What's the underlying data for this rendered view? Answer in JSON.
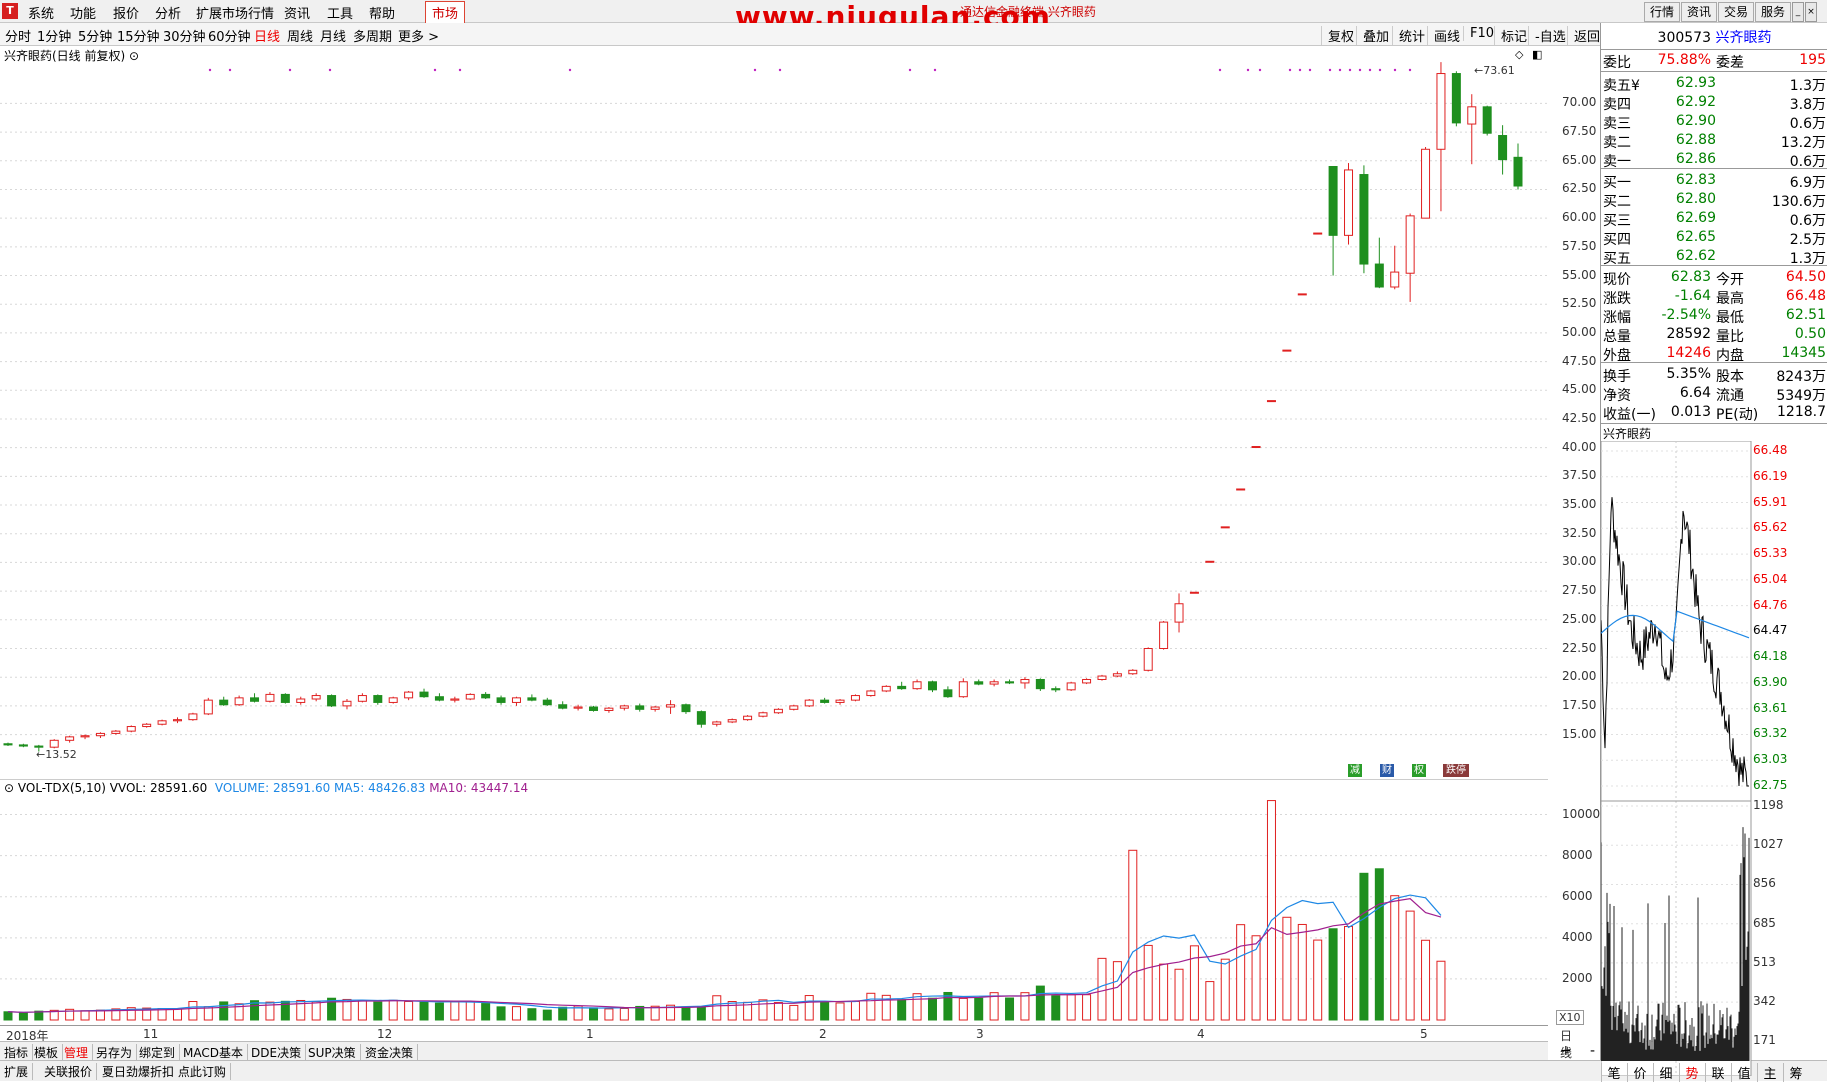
{
  "menu": {
    "items": [
      "系统",
      "功能",
      "报价",
      "分析",
      "扩展市场行情",
      "资讯",
      "工具",
      "帮助"
    ],
    "market_label": "市场",
    "watermark": "www.niugulan.com",
    "title": "通达信金融终端 兴齐眼药",
    "right_buttons": [
      "行情",
      "资讯",
      "交易",
      "服务"
    ]
  },
  "periods": {
    "items": [
      "分时",
      "1分钟",
      "5分钟",
      "15分钟",
      "30分钟",
      "60分钟",
      "日线",
      "周线",
      "月线",
      "多周期",
      "更多 >"
    ],
    "active": "日线",
    "tools": [
      "复权",
      "叠加",
      "统计",
      "画线",
      "F10",
      "标记",
      "-自选",
      "返回"
    ]
  },
  "chart": {
    "title": "兴齐眼药(日线 前复权)",
    "y_labels": [
      "70.00",
      "67.50",
      "65.00",
      "62.50",
      "60.00",
      "57.50",
      "55.00",
      "52.50",
      "50.00",
      "47.50",
      "45.00",
      "42.50",
      "40.00",
      "37.50",
      "35.00",
      "32.50",
      "30.00",
      "27.50",
      "25.00",
      "22.50",
      "20.00",
      "17.50",
      "15.00"
    ],
    "high_marker": "73.61",
    "low_marker": "13.52",
    "indicator_buttons": [
      "减",
      "财",
      "权",
      "跌停"
    ]
  },
  "volume": {
    "legend_name": "VOL-TDX(5,10)",
    "vvol": "VVOL: 28591.60",
    "volume": "VOLUME: 28591.60",
    "ma5": "MA5: 48426.83",
    "ma10": "MA10: 43447.14",
    "y_labels": [
      "10000",
      "8000",
      "6000",
      "4000",
      "2000"
    ],
    "unit": "X10"
  },
  "dates": {
    "labels": [
      "2018年",
      "11",
      "12",
      "1",
      "2",
      "3",
      "4",
      "5"
    ],
    "period_label": "日线"
  },
  "bottom": {
    "row1": [
      "指标",
      "模板",
      "管理",
      "另存为",
      "绑定到",
      "MACD基本",
      "DDE决策",
      "SUP决策",
      "资金决策"
    ],
    "row1_active": "管理",
    "row2": [
      "扩展",
      "关联报价",
      "夏日劲爆折扣 点此订购"
    ]
  },
  "quote": {
    "code": "300573",
    "name": "兴齐眼药",
    "weibi_label": "委比",
    "weibi": "75.88%",
    "weicha_label": "委差",
    "weicha": "195",
    "sells": [
      {
        "label": "卖五",
        "mark": "¥",
        "price": "62.93",
        "vol": "1.3万"
      },
      {
        "label": "卖四",
        "mark": "",
        "price": "62.92",
        "vol": "3.8万"
      },
      {
        "label": "卖三",
        "mark": "",
        "price": "62.90",
        "vol": "0.6万"
      },
      {
        "label": "卖二",
        "mark": "",
        "price": "62.88",
        "vol": "13.2万"
      },
      {
        "label": "卖一",
        "mark": "",
        "price": "62.86",
        "vol": "0.6万"
      }
    ],
    "buys": [
      {
        "label": "买一",
        "price": "62.83",
        "vol": "6.9万"
      },
      {
        "label": "买二",
        "price": "62.80",
        "vol": "130.6万"
      },
      {
        "label": "买三",
        "price": "62.69",
        "vol": "0.6万"
      },
      {
        "label": "买四",
        "price": "62.65",
        "vol": "2.5万"
      },
      {
        "label": "买五",
        "price": "62.62",
        "vol": "1.3万"
      }
    ],
    "stats": [
      {
        "l1": "现价",
        "v1": "62.83",
        "c1": "green",
        "l2": "今开",
        "v2": "64.50",
        "c2": "red"
      },
      {
        "l1": "涨跌",
        "v1": "-1.64",
        "c1": "green",
        "l2": "最高",
        "v2": "66.48",
        "c2": "red"
      },
      {
        "l1": "涨幅",
        "v1": "-2.54%",
        "c1": "green",
        "l2": "最低",
        "v2": "62.51",
        "c2": "green"
      },
      {
        "l1": "总量",
        "v1": "28592",
        "c1": "black",
        "l2": "量比",
        "v2": "0.50",
        "c2": "green"
      },
      {
        "l1": "外盘",
        "v1": "14246",
        "c1": "red",
        "l2": "内盘",
        "v2": "14345",
        "c2": "green"
      }
    ],
    "stats2": [
      {
        "l1": "换手",
        "v1": "5.35%",
        "l2": "股本",
        "v2": "8243万"
      },
      {
        "l1": "净资",
        "v1": "6.64",
        "l2": "流通",
        "v2": "5349万"
      },
      {
        "l1": "收益(一)",
        "v1": "0.013",
        "l2": "PE(动)",
        "v2": "1218.7"
      }
    ],
    "mini_title": "兴齐眼药",
    "mini_y_labels": [
      "66.48",
      "66.19",
      "65.91",
      "65.62",
      "65.33",
      "65.04",
      "64.76",
      "64.47",
      "64.18",
      "63.90",
      "63.61",
      "63.32",
      "63.03",
      "62.75"
    ],
    "mini_vol_labels": [
      "1198",
      "1027",
      "856",
      "685",
      "513",
      "342",
      "171"
    ],
    "tabs": [
      "笔",
      "价",
      "细",
      "势",
      "联",
      "值",
      "主",
      "筹"
    ],
    "active_tab": "势"
  },
  "chart_data": {
    "type": "candlestick",
    "price_range": [
      13.52,
      73.61
    ],
    "candles": [
      [
        14.2,
        14.3,
        14.0,
        14.1
      ],
      [
        14.1,
        14.2,
        13.9,
        14.0
      ],
      [
        14.0,
        14.1,
        13.52,
        13.9
      ],
      [
        13.9,
        14.6,
        13.8,
        14.5
      ],
      [
        14.5,
        14.9,
        14.3,
        14.8
      ],
      [
        14.8,
        15.0,
        14.6,
        14.9
      ],
      [
        14.9,
        15.2,
        14.7,
        15.1
      ],
      [
        15.1,
        15.4,
        15.0,
        15.3
      ],
      [
        15.3,
        15.8,
        15.2,
        15.7
      ],
      [
        15.7,
        16.0,
        15.6,
        15.9
      ],
      [
        15.9,
        16.3,
        15.8,
        16.2
      ],
      [
        16.2,
        16.5,
        16.0,
        16.3
      ],
      [
        16.3,
        16.9,
        16.2,
        16.8
      ],
      [
        16.8,
        18.2,
        16.7,
        18.0
      ],
      [
        18.0,
        18.3,
        17.5,
        17.6
      ],
      [
        17.6,
        18.4,
        17.5,
        18.2
      ],
      [
        18.2,
        18.6,
        17.8,
        17.9
      ],
      [
        17.9,
        18.7,
        17.8,
        18.5
      ],
      [
        18.5,
        18.6,
        17.7,
        17.8
      ],
      [
        17.8,
        18.3,
        17.6,
        18.1
      ],
      [
        18.1,
        18.6,
        17.9,
        18.4
      ],
      [
        18.4,
        18.5,
        17.4,
        17.5
      ],
      [
        17.5,
        18.1,
        17.2,
        17.9
      ],
      [
        17.9,
        18.6,
        17.8,
        18.4
      ],
      [
        18.4,
        18.5,
        17.6,
        17.8
      ],
      [
        17.8,
        18.3,
        17.7,
        18.2
      ],
      [
        18.2,
        18.8,
        18.0,
        18.7
      ],
      [
        18.7,
        19.0,
        18.2,
        18.3
      ],
      [
        18.3,
        18.6,
        17.9,
        18.0
      ],
      [
        18.0,
        18.3,
        17.8,
        18.1
      ],
      [
        18.1,
        18.6,
        18.0,
        18.5
      ],
      [
        18.5,
        18.7,
        18.1,
        18.2
      ],
      [
        18.2,
        18.4,
        17.6,
        17.8
      ],
      [
        17.8,
        18.3,
        17.5,
        18.2
      ],
      [
        18.2,
        18.5,
        17.9,
        18.0
      ],
      [
        18.0,
        18.2,
        17.5,
        17.6
      ],
      [
        17.6,
        17.9,
        17.2,
        17.3
      ],
      [
        17.3,
        17.6,
        17.1,
        17.4
      ],
      [
        17.4,
        17.5,
        17.0,
        17.1
      ],
      [
        17.1,
        17.4,
        16.9,
        17.3
      ],
      [
        17.3,
        17.6,
        17.1,
        17.5
      ],
      [
        17.5,
        17.7,
        17.0,
        17.2
      ],
      [
        17.2,
        17.5,
        17.0,
        17.4
      ],
      [
        17.4,
        18.0,
        16.8,
        17.6
      ],
      [
        17.6,
        17.7,
        16.8,
        17.0
      ],
      [
        17.0,
        17.1,
        15.6,
        15.9
      ],
      [
        15.9,
        16.2,
        15.7,
        16.1
      ],
      [
        16.1,
        16.4,
        16.0,
        16.3
      ],
      [
        16.3,
        16.7,
        16.2,
        16.6
      ],
      [
        16.6,
        17.0,
        16.5,
        16.9
      ],
      [
        16.9,
        17.3,
        16.8,
        17.2
      ],
      [
        17.2,
        17.6,
        17.1,
        17.5
      ],
      [
        17.5,
        18.1,
        17.4,
        18.0
      ],
      [
        18.0,
        18.2,
        17.7,
        17.8
      ],
      [
        17.8,
        18.1,
        17.6,
        18.0
      ],
      [
        18.0,
        18.5,
        17.9,
        18.4
      ],
      [
        18.4,
        18.9,
        18.3,
        18.8
      ],
      [
        18.8,
        19.3,
        18.7,
        19.2
      ],
      [
        19.2,
        19.6,
        18.9,
        19.0
      ],
      [
        19.0,
        19.8,
        18.9,
        19.6
      ],
      [
        19.6,
        19.7,
        18.7,
        18.9
      ],
      [
        18.9,
        19.2,
        18.2,
        18.3
      ],
      [
        18.3,
        19.9,
        18.2,
        19.6
      ],
      [
        19.6,
        19.8,
        19.3,
        19.4
      ],
      [
        19.4,
        19.8,
        19.2,
        19.6
      ],
      [
        19.6,
        19.8,
        19.4,
        19.5
      ],
      [
        19.5,
        20.0,
        19.0,
        19.8
      ],
      [
        19.8,
        19.9,
        18.8,
        19.0
      ],
      [
        19.0,
        19.2,
        18.7,
        18.9
      ],
      [
        18.9,
        19.6,
        18.8,
        19.5
      ],
      [
        19.5,
        19.9,
        19.4,
        19.8
      ],
      [
        19.8,
        20.2,
        19.7,
        20.1
      ],
      [
        20.1,
        20.5,
        20.0,
        20.3
      ],
      [
        20.3,
        20.7,
        20.2,
        20.6
      ],
      [
        20.6,
        22.6,
        20.5,
        22.5
      ],
      [
        22.5,
        24.9,
        22.4,
        24.8
      ],
      [
        24.8,
        27.3,
        23.9,
        26.4
      ],
      [
        27.4,
        27.4,
        27.4,
        27.4
      ],
      [
        30.1,
        30.1,
        30.1,
        30.1
      ],
      [
        33.1,
        33.1,
        33.1,
        33.1
      ],
      [
        36.4,
        36.4,
        36.4,
        36.4
      ],
      [
        40.1,
        40.1,
        40.1,
        40.1
      ],
      [
        44.1,
        44.1,
        44.1,
        44.1
      ],
      [
        48.5,
        48.5,
        48.5,
        48.5
      ],
      [
        53.4,
        53.4,
        53.4,
        53.4
      ],
      [
        58.7,
        58.7,
        58.7,
        58.7
      ],
      [
        64.5,
        64.5,
        55.0,
        58.5
      ],
      [
        58.5,
        64.8,
        57.7,
        64.2
      ],
      [
        63.8,
        64.6,
        55.2,
        56.0
      ],
      [
        56.0,
        58.3,
        53.9,
        54.0
      ],
      [
        54.0,
        57.6,
        53.8,
        55.3
      ],
      [
        55.2,
        60.4,
        52.7,
        60.2
      ],
      [
        60.0,
        66.2,
        60.0,
        66.0
      ],
      [
        66.0,
        73.6,
        60.6,
        72.6
      ],
      [
        72.6,
        72.8,
        68.0,
        68.3
      ],
      [
        68.2,
        70.8,
        64.7,
        69.7
      ],
      [
        69.7,
        69.8,
        67.2,
        67.4
      ],
      [
        67.2,
        68.1,
        63.8,
        65.1
      ],
      [
        65.3,
        66.5,
        62.5,
        62.8
      ]
    ],
    "volume_series": [
      400,
      350,
      430,
      470,
      520,
      450,
      480,
      540,
      600,
      580,
      560,
      530,
      900,
      650,
      880,
      790,
      940,
      870,
      910,
      950,
      890,
      1060,
      1000,
      930,
      870,
      960,
      900,
      870,
      820,
      880,
      890,
      800,
      640,
      650,
      550,
      480,
      620,
      680,
      590,
      540,
      560,
      660,
      670,
      720,
      640,
      660,
      1180,
      900,
      860,
      980,
      850,
      710,
      1190,
      880,
      830,
      900,
      1300,
      1200,
      990,
      1280,
      1060,
      1340,
      1050,
      1060,
      1330,
      1070,
      1330,
      1650,
      1180,
      1230,
      1230,
      3000,
      2840,
      8260,
      3630,
      2720,
      2470,
      3610,
      1870,
      2960,
      4640,
      4100,
      10680,
      5000,
      4650,
      3890,
      4440,
      4550,
      7140,
      7360,
      6050,
      5300,
      3880,
      2860
    ],
    "mini_price_range": [
      62.75,
      66.48
    ]
  }
}
